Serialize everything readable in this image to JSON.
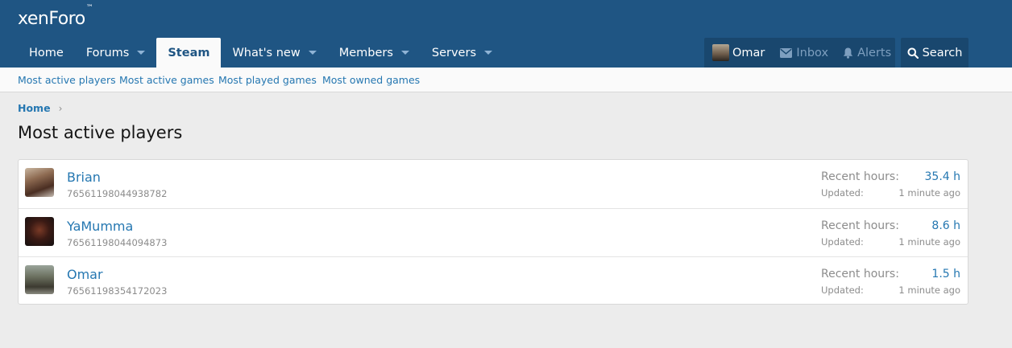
{
  "header": {
    "logo_text": "xenForo",
    "logo_mark": "™"
  },
  "nav": {
    "items": [
      {
        "label": "Home"
      },
      {
        "label": "Forums"
      },
      {
        "label": "Steam"
      },
      {
        "label": "What's new"
      },
      {
        "label": "Members"
      },
      {
        "label": "Servers"
      }
    ],
    "active": "Steam"
  },
  "account": {
    "username": "Omar",
    "inbox_label": "Inbox",
    "alerts_label": "Alerts",
    "search_label": "Search"
  },
  "subnav": {
    "items": [
      {
        "label": "Most active players"
      },
      {
        "label": "Most active games"
      },
      {
        "label": "Most played games"
      },
      {
        "label": "Most owned games"
      }
    ]
  },
  "breadcrumb": {
    "home": "Home",
    "separator": "›"
  },
  "page": {
    "title": "Most active players"
  },
  "players": [
    {
      "name": "Brian",
      "steam_id": "76561198044938782",
      "recent_label": "Recent hours:",
      "recent_hours": "35.4 h",
      "updated_label": "Updated:",
      "updated": "1 minute ago"
    },
    {
      "name": "YaMumma",
      "steam_id": "76561198044094873",
      "recent_label": "Recent hours:",
      "recent_hours": "8.6 h",
      "updated_label": "Updated:",
      "updated": "1 minute ago"
    },
    {
      "name": "Omar",
      "steam_id": "76561198354172023",
      "recent_label": "Recent hours:",
      "recent_hours": "1.5 h",
      "updated_label": "Updated:",
      "updated": "1 minute ago"
    }
  ],
  "colors": {
    "header_bg": "#1f5583",
    "link": "#2577b1",
    "muted": "#8c8c8c"
  }
}
